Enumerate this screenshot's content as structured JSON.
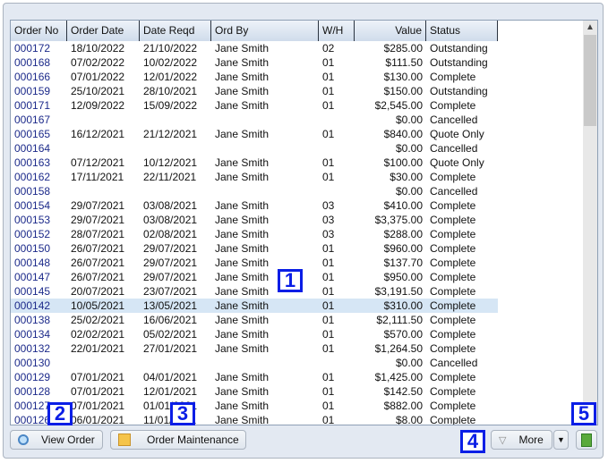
{
  "columns": [
    "Order No",
    "Order Date",
    "Date Reqd",
    "Ord By",
    "W/H",
    "Value",
    "Status"
  ],
  "rows": [
    [
      "000172",
      "18/10/2022",
      "21/10/2022",
      "Jane Smith",
      "02",
      "$285.00",
      "Outstanding"
    ],
    [
      "000168",
      "07/02/2022",
      "10/02/2022",
      "Jane Smith",
      "01",
      "$111.50",
      "Outstanding"
    ],
    [
      "000166",
      "07/01/2022",
      "12/01/2022",
      "Jane Smith",
      "01",
      "$130.00",
      "Complete"
    ],
    [
      "000159",
      "25/10/2021",
      "28/10/2021",
      "Jane Smith",
      "01",
      "$150.00",
      "Outstanding"
    ],
    [
      "000171",
      "12/09/2022",
      "15/09/2022",
      "Jane Smith",
      "01",
      "$2,545.00",
      "Complete"
    ],
    [
      "000167",
      "",
      "",
      "",
      "",
      "$0.00",
      "Cancelled"
    ],
    [
      "000165",
      "16/12/2021",
      "21/12/2021",
      "Jane Smith",
      "01",
      "$840.00",
      "Quote Only"
    ],
    [
      "000164",
      "",
      "",
      "",
      "",
      "$0.00",
      "Cancelled"
    ],
    [
      "000163",
      "07/12/2021",
      "10/12/2021",
      "Jane Smith",
      "01",
      "$100.00",
      "Quote Only"
    ],
    [
      "000162",
      "17/11/2021",
      "22/11/2021",
      "Jane Smith",
      "01",
      "$30.00",
      "Complete"
    ],
    [
      "000158",
      "",
      "",
      "",
      "",
      "$0.00",
      "Cancelled"
    ],
    [
      "000154",
      "29/07/2021",
      "03/08/2021",
      "Jane Smith",
      "03",
      "$410.00",
      "Complete"
    ],
    [
      "000153",
      "29/07/2021",
      "03/08/2021",
      "Jane Smith",
      "03",
      "$3,375.00",
      "Complete"
    ],
    [
      "000152",
      "28/07/2021",
      "02/08/2021",
      "Jane Smith",
      "03",
      "$288.00",
      "Complete"
    ],
    [
      "000150",
      "26/07/2021",
      "29/07/2021",
      "Jane Smith",
      "01",
      "$960.00",
      "Complete"
    ],
    [
      "000148",
      "26/07/2021",
      "29/07/2021",
      "Jane Smith",
      "01",
      "$137.70",
      "Complete"
    ],
    [
      "000147",
      "26/07/2021",
      "29/07/2021",
      "Jane Smith",
      "01",
      "$950.00",
      "Complete"
    ],
    [
      "000145",
      "20/07/2021",
      "23/07/2021",
      "Jane Smith",
      "01",
      "$3,191.50",
      "Complete"
    ],
    [
      "000142",
      "10/05/2021",
      "13/05/2021",
      "Jane Smith",
      "01",
      "$310.00",
      "Complete"
    ],
    [
      "000138",
      "25/02/2021",
      "16/06/2021",
      "Jane Smith",
      "01",
      "$2,111.50",
      "Complete"
    ],
    [
      "000134",
      "02/02/2021",
      "05/02/2021",
      "Jane Smith",
      "01",
      "$570.00",
      "Complete"
    ],
    [
      "000132",
      "22/01/2021",
      "27/01/2021",
      "Jane Smith",
      "01",
      "$1,264.50",
      "Complete"
    ],
    [
      "000130",
      "",
      "",
      "",
      "",
      "$0.00",
      "Cancelled"
    ],
    [
      "000129",
      "07/01/2021",
      "04/01/2021",
      "Jane Smith",
      "01",
      "$1,425.00",
      "Complete"
    ],
    [
      "000128",
      "07/01/2021",
      "12/01/2021",
      "Jane Smith",
      "01",
      "$142.50",
      "Complete"
    ],
    [
      "000127",
      "07/01/2021",
      "01/01/2021",
      "Jane Smith",
      "01",
      "$882.00",
      "Complete"
    ],
    [
      "000126",
      "06/01/2021",
      "11/01/2021",
      "Jane Smith",
      "01",
      "$8.00",
      "Complete"
    ]
  ],
  "selected_row": "000142",
  "buttons": {
    "view_order": "View Order",
    "order_maintenance": "Order Maintenance",
    "more": "More"
  },
  "icons": {
    "view_order": "magnifier-icon",
    "order_maintenance": "edit-note-icon",
    "more": "triangle-down-icon",
    "export": "excel-export-icon"
  },
  "callouts": [
    "1",
    "2",
    "3",
    "4",
    "5"
  ]
}
